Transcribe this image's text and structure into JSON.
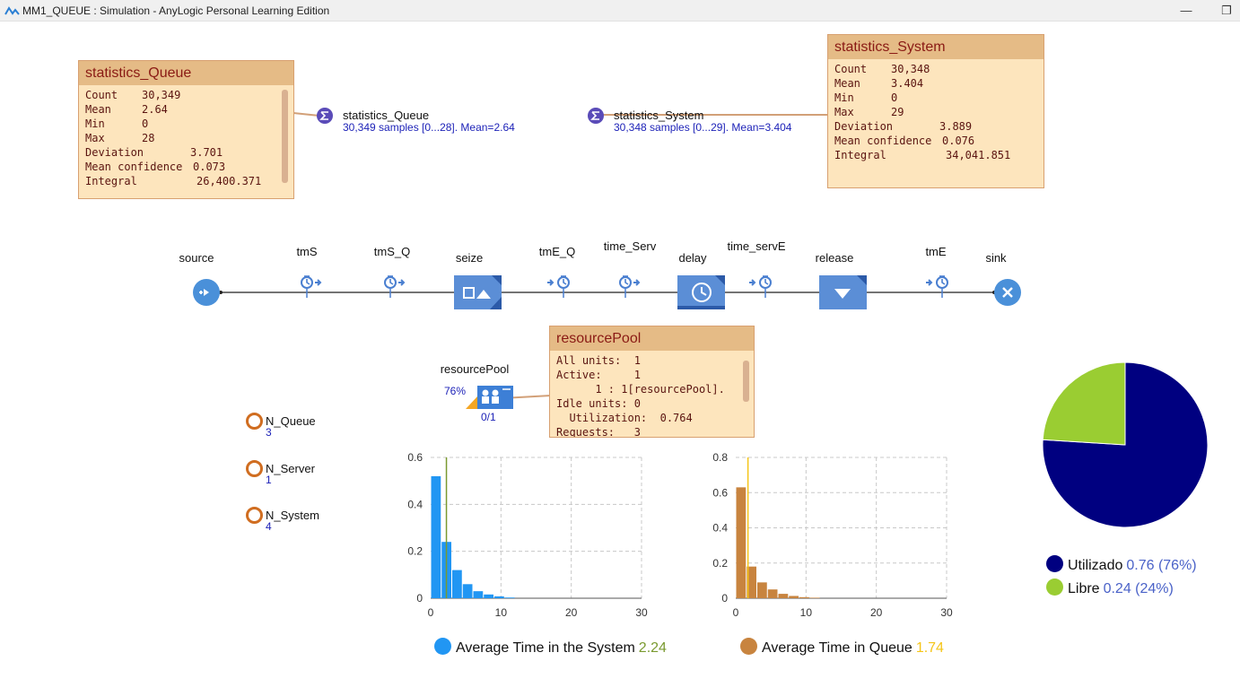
{
  "window": {
    "title": "MM1_QUEUE : Simulation - AnyLogic Personal Learning Edition",
    "minimize_glyph": "—",
    "restore_glyph": "❐"
  },
  "statistics_queue_box": {
    "title": "statistics_Queue",
    "rows": [
      {
        "key": "Count",
        "value": "30,349"
      },
      {
        "key": "Mean",
        "value": "2.64"
      },
      {
        "key": "Min",
        "value": "0"
      },
      {
        "key": "Max",
        "value": "28"
      },
      {
        "key": "Deviation",
        "value": "3.701"
      },
      {
        "key": "Mean confidence",
        "value": "0.073"
      },
      {
        "key": "Integral",
        "value": "26,400.371"
      }
    ]
  },
  "statistics_system_box": {
    "title": "statistics_System",
    "rows": [
      {
        "key": "Count",
        "value": "30,348"
      },
      {
        "key": "Mean",
        "value": "3.404"
      },
      {
        "key": "Min",
        "value": "0"
      },
      {
        "key": "Max",
        "value": "29"
      },
      {
        "key": "Deviation",
        "value": "3.889"
      },
      {
        "key": "Mean confidence",
        "value": "0.076"
      },
      {
        "key": "Integral",
        "value": "34,041.851"
      }
    ]
  },
  "statistics_queue_obj": {
    "name": "statistics_Queue",
    "info": "30,349 samples [0...28]. Mean=2.64",
    "icon": "sigma-icon"
  },
  "statistics_system_obj": {
    "name": "statistics_System",
    "info": "30,348 samples [0...29]. Mean=3.404",
    "icon": "sigma-icon"
  },
  "flow": {
    "labels": {
      "source": "source",
      "tmS": "tmS",
      "tmS_Q": "tmS_Q",
      "seize": "seize",
      "tmE_Q": "tmE_Q",
      "time_Serv": "time_Serv",
      "delay": "delay",
      "time_servE": "time_servE",
      "release": "release",
      "tmE": "tmE",
      "sink": "sink"
    },
    "icons": {
      "source": "source-icon",
      "time_measure_start": "time-measure-start-icon",
      "time_measure_end": "time-measure-end-icon",
      "seize": "seize-icon",
      "delay": "delay-clock-icon",
      "release": "release-icon",
      "sink": "sink-icon"
    }
  },
  "resource_pool": {
    "label": "resourcePool",
    "utilization_pct": "76%",
    "units": "0/1",
    "icon": "resource-pool-icon"
  },
  "resource_pool_box": {
    "title": "resourcePool",
    "lines": [
      "All units:  1",
      "Active:     1",
      "      1 : 1[resourcePool].",
      "Idle units: 0",
      "  Utilization:  0.764",
      "Requests:   3"
    ]
  },
  "variables": [
    {
      "name": "N_Queue",
      "value": "3",
      "icon": "variable-icon"
    },
    {
      "name": "N_Server",
      "value": "1",
      "icon": "variable-icon"
    },
    {
      "name": "N_System",
      "value": "4",
      "icon": "variable-icon"
    }
  ],
  "colors": {
    "system_hist": "#2196f3",
    "system_mean": "#7a9a30",
    "queue_hist": "#c8843f",
    "queue_mean": "#f5c518",
    "pie_utilizado": "#000080",
    "pie_libre": "#9acd32",
    "legend_value": "#4a62c8",
    "flow_block": "#5b8ed6"
  },
  "chart_data": [
    {
      "type": "bar",
      "xlim": [
        0,
        30
      ],
      "ylim": [
        0,
        0.6
      ],
      "x_ticks": [
        "0",
        "10",
        "20",
        "30"
      ],
      "y_ticks": [
        "0",
        "0.2",
        "0.4",
        "0.6"
      ],
      "bins": [
        {
          "x0": 0,
          "x1": 1.5,
          "value": 0.52
        },
        {
          "x0": 1.5,
          "x1": 3,
          "value": 0.24
        },
        {
          "x0": 3,
          "x1": 4.5,
          "value": 0.12
        },
        {
          "x0": 4.5,
          "x1": 6,
          "value": 0.06
        },
        {
          "x0": 6,
          "x1": 7.5,
          "value": 0.03
        },
        {
          "x0": 7.5,
          "x1": 9,
          "value": 0.016
        },
        {
          "x0": 9,
          "x1": 10.5,
          "value": 0.008
        },
        {
          "x0": 10.5,
          "x1": 12,
          "value": 0.003
        }
      ],
      "mean": 2.24,
      "legend": {
        "label": "Average Time in the System",
        "value": "2.24"
      }
    },
    {
      "type": "bar",
      "xlim": [
        0,
        30
      ],
      "ylim": [
        0,
        0.8
      ],
      "x_ticks": [
        "0",
        "10",
        "20",
        "30"
      ],
      "y_ticks": [
        "0",
        "0.2",
        "0.4",
        "0.6",
        "0.8"
      ],
      "bins": [
        {
          "x0": 0,
          "x1": 1.5,
          "value": 0.63
        },
        {
          "x0": 1.5,
          "x1": 3,
          "value": 0.18
        },
        {
          "x0": 3,
          "x1": 4.5,
          "value": 0.09
        },
        {
          "x0": 4.5,
          "x1": 6,
          "value": 0.05
        },
        {
          "x0": 6,
          "x1": 7.5,
          "value": 0.025
        },
        {
          "x0": 7.5,
          "x1": 9,
          "value": 0.013
        },
        {
          "x0": 9,
          "x1": 10.5,
          "value": 0.006
        },
        {
          "x0": 10.5,
          "x1": 12,
          "value": 0.003
        }
      ],
      "mean": 1.74,
      "legend": {
        "label": "Average Time in Queue",
        "value": "1.74"
      }
    },
    {
      "type": "pie",
      "slices": [
        {
          "label": "Utilizado",
          "value": 0.76,
          "value_text": "0.76 (76%)"
        },
        {
          "label": "Libre",
          "value": 0.24,
          "value_text": "0.24 (24%)"
        }
      ]
    }
  ]
}
